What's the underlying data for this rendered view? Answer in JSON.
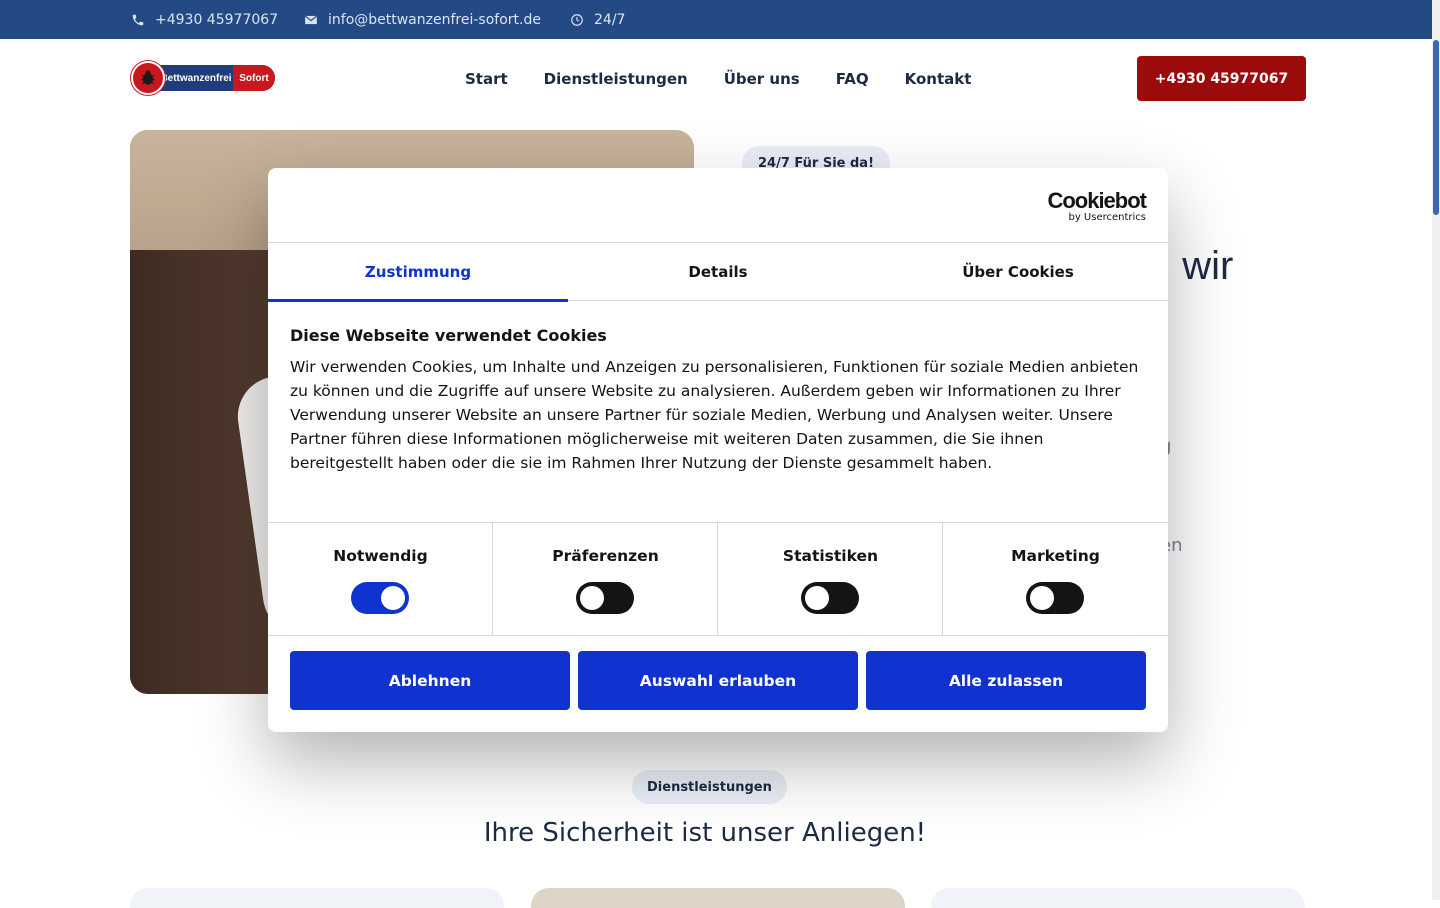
{
  "topbar": {
    "phone": "+4930 45977067",
    "email": "info@bettwanzenfrei-sofort.de",
    "hours": "24/7",
    "icons": [
      "phone-icon",
      "mail-icon",
      "clock-icon"
    ]
  },
  "header": {
    "logo": {
      "part1": "Bettwanzenfrei",
      "part2": "Sofort"
    },
    "nav": [
      "Start",
      "Dienstleistungen",
      "Über uns",
      "FAQ",
      "Kontakt"
    ],
    "cta": "+4930 45977067"
  },
  "hero": {
    "badge": "24/7 Für Sie da!",
    "title_fragment": ", wir",
    "text_fragment_1": "g",
    "text_fragment_2": "en"
  },
  "services": {
    "badge": "Dienstleistungen",
    "title": "Ihre Sicherheit ist unser Anliegen!"
  },
  "cookie_dialog": {
    "brand": {
      "name": "Cookiebot",
      "sub": "by Usercentrics"
    },
    "tabs": [
      "Zustimmung",
      "Details",
      "Über Cookies"
    ],
    "active_tab": "Zustimmung",
    "title": "Diese Webseite verwendet Cookies",
    "text": "Wir verwenden Cookies, um Inhalte und Anzeigen zu personalisieren, Funktionen für soziale Medien anbieten zu können und die Zugriffe auf unsere Website zu analysieren. Außerdem geben wir Informationen zu Ihrer Verwendung unserer Website an unsere Partner für soziale Medien, Werbung und Analysen weiter. Unsere Partner führen diese Informationen möglicherweise mit weiteren Daten zusammen, die Sie ihnen bereitgestellt haben oder die sie im Rahmen Ihrer Nutzung der Dienste gesammelt haben.",
    "toggles": [
      {
        "label": "Notwendig",
        "on": true
      },
      {
        "label": "Präferenzen",
        "on": false
      },
      {
        "label": "Statistiken",
        "on": false
      },
      {
        "label": "Marketing",
        "on": false
      }
    ],
    "buttons": [
      "Ablehnen",
      "Auswahl erlauben",
      "Alle zulassen"
    ]
  },
  "colors": {
    "topbar": "#244a86",
    "cta": "#9b0b0b",
    "accent": "#1032cf"
  }
}
